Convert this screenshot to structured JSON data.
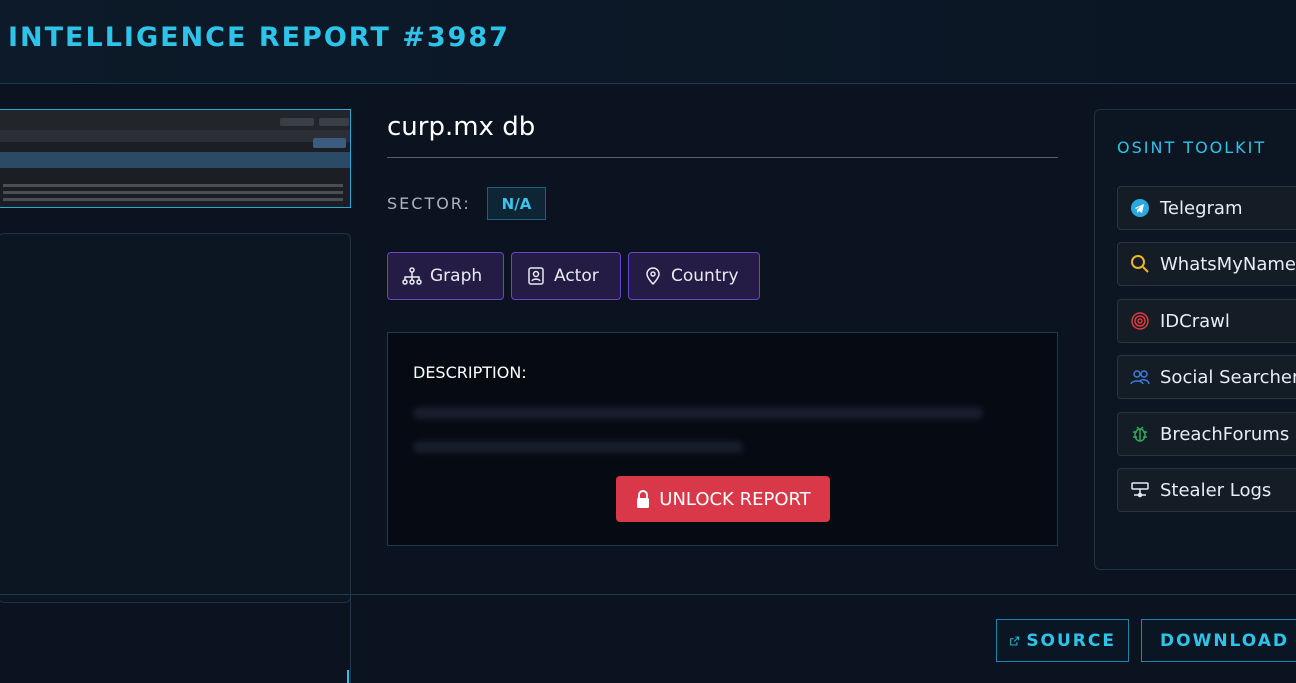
{
  "header": {
    "title": "INTELLIGENCE REPORT #3987"
  },
  "report": {
    "title": "curp.mx db",
    "sector_label": "SECTOR:",
    "sector_value": "N/A",
    "tags": [
      {
        "label": "Graph",
        "icon": "graph-icon"
      },
      {
        "label": "Actor",
        "icon": "actor-icon"
      },
      {
        "label": "Country",
        "icon": "map-pin-icon"
      }
    ],
    "description_label": "DESCRIPTION:",
    "unlock_label": "UNLOCK REPORT"
  },
  "osint": {
    "title": "OSINT TOOLKIT",
    "tools": [
      {
        "label": "Telegram",
        "icon": "telegram-icon",
        "color": "#2aa8e0"
      },
      {
        "label": "WhatsMyName",
        "icon": "search-icon",
        "color": "#f0b429"
      },
      {
        "label": "IDCrawl",
        "icon": "fingerprint-icon",
        "color": "#e03a3a"
      },
      {
        "label": "Social Searcher",
        "icon": "users-icon",
        "color": "#3a7de0"
      },
      {
        "label": "BreachForums",
        "icon": "bug-icon",
        "color": "#2fa85a"
      },
      {
        "label": "Stealer Logs",
        "icon": "server-icon",
        "color": "#e6edf5"
      }
    ]
  },
  "actions": {
    "source_label": "SOURCE",
    "download_label": "DOWNLOAD"
  },
  "colors": {
    "accent": "#2ec4ea",
    "danger": "#d93848",
    "tag_border": "#6a45c8"
  }
}
